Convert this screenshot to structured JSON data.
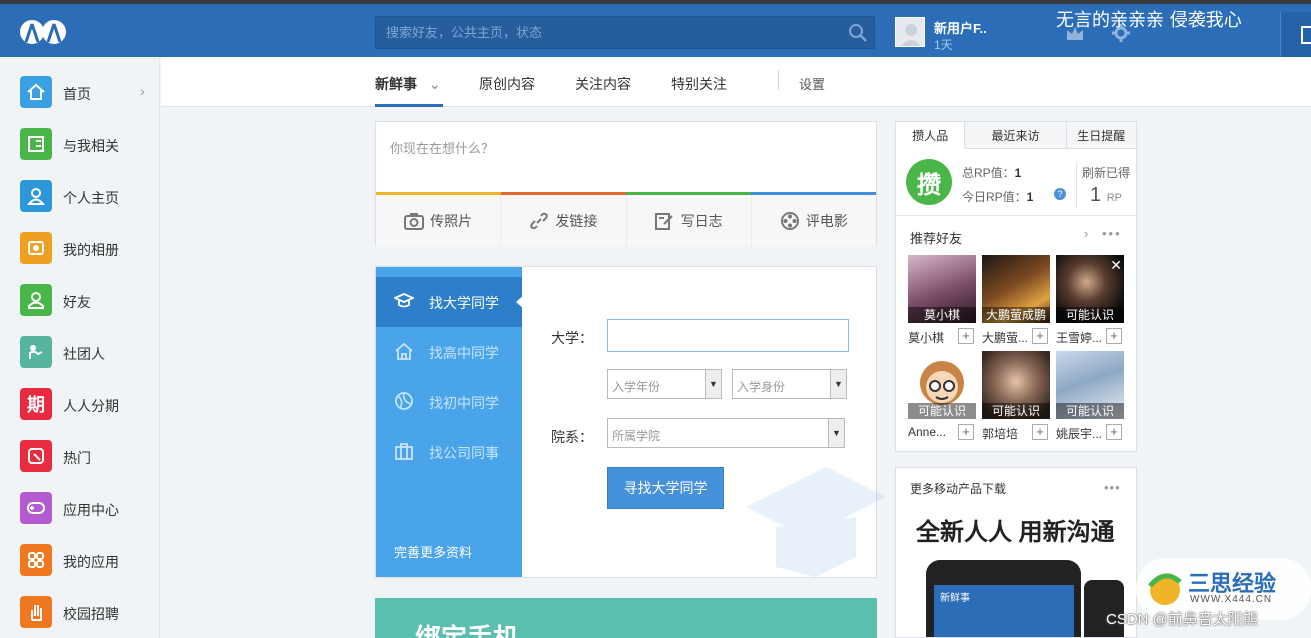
{
  "header": {
    "search_placeholder": "搜索好友，公共主页，状态",
    "user_name": "新用户F..",
    "user_days": "1天",
    "signature": "无言的亲亲亲 侵袭我心"
  },
  "sidebar": {
    "items": [
      {
        "label": "首页",
        "icon": "home-icon",
        "color": "#3aa0e4"
      },
      {
        "label": "与我相关",
        "icon": "contact-card-icon",
        "color": "#4ab64a"
      },
      {
        "label": "个人主页",
        "icon": "person-icon",
        "color": "#2d98d9"
      },
      {
        "label": "我的相册",
        "icon": "album-icon",
        "color": "#f0a020"
      },
      {
        "label": "好友",
        "icon": "friends-icon",
        "color": "#4ab64a"
      },
      {
        "label": "社团人",
        "icon": "club-icon",
        "color": "#55b59e"
      },
      {
        "label": "人人分期",
        "icon": "installment-icon",
        "color": "#e82b3e"
      },
      {
        "label": "热门",
        "icon": "hot-icon",
        "color": "#e82b3e"
      },
      {
        "label": "应用中心",
        "icon": "gamepad-icon",
        "color": "#b25cd0"
      },
      {
        "label": "我的应用",
        "icon": "apps-grid-icon",
        "color": "#f07820"
      },
      {
        "label": "校园招聘",
        "icon": "hand-icon",
        "color": "#f07820"
      }
    ]
  },
  "nav": {
    "tabs": [
      "新鲜事",
      "原创内容",
      "关注内容",
      "特别关注"
    ],
    "settings": "设置"
  },
  "composer": {
    "placeholder": "你现在在想什么？",
    "stripe_colors": [
      "#f0b429",
      "#e36a2e",
      "#4ab64a",
      "#3d8fd9"
    ],
    "buttons": [
      "传照片",
      "发链接",
      "写日志",
      "评电影"
    ]
  },
  "finder": {
    "options": [
      "找大学同学",
      "找高中同学",
      "找初中同学",
      "找公司同事"
    ],
    "more": "完善更多资料",
    "university_label": "大学：",
    "year_placeholder": "入学年份",
    "identity_placeholder": "入学身份",
    "dept_label": "院系：",
    "dept_placeholder": "所属学院",
    "submit": "寻找大学同学"
  },
  "bind_banner": "绑定手机",
  "rp": {
    "tabs": [
      "攒人品",
      "最近来访",
      "生日提醒"
    ],
    "logo_char": "攒",
    "total_label": "总RP值：",
    "total_value": "1",
    "today_label": "今日RP值：",
    "today_value": "1",
    "refresh_label": "刷新已得",
    "refresh_value": "1",
    "refresh_unit": "RP",
    "rec_title": "推荐好友",
    "friends": [
      {
        "caption": "莫小棋",
        "name": "莫小棋"
      },
      {
        "caption": "大鹏萤成鹏",
        "name": "大鹏萤..."
      },
      {
        "caption": "可能认识",
        "name": "王雪婷..."
      },
      {
        "caption": "可能认识",
        "name": "Anne..."
      },
      {
        "caption": "可能认识",
        "name": "郭培培"
      },
      {
        "caption": "可能认识",
        "name": "姚辰宇..."
      }
    ]
  },
  "mobile": {
    "title": "更多移动产品下载",
    "headline": "全新人人 用新沟通",
    "screen_label": "新鲜事"
  },
  "watermarks": {
    "brand": "三思经验",
    "url": "WWW.X444.CN",
    "csdn": "CSDN @前鼻音太阳熊"
  }
}
